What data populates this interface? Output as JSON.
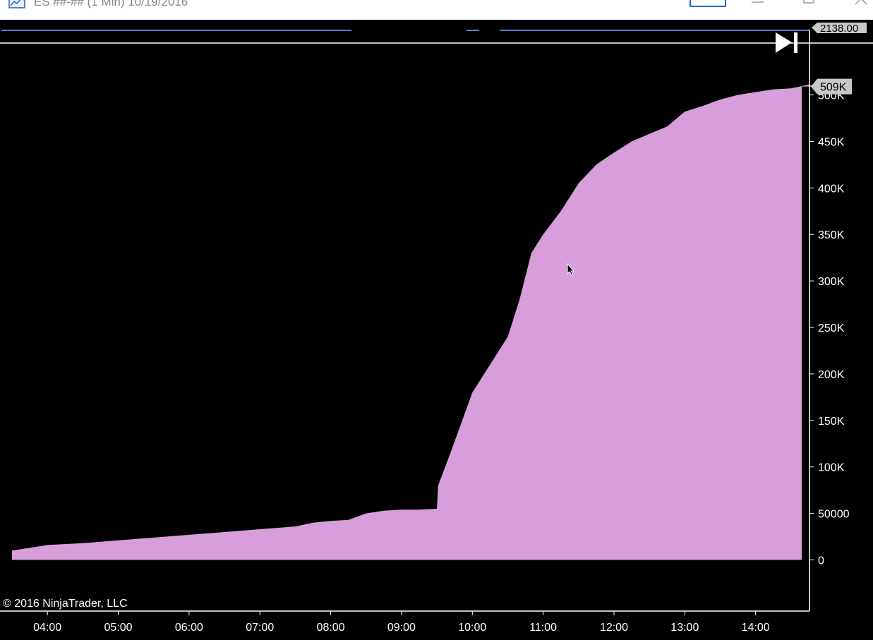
{
  "window": {
    "title": "ES ##-## (1 Min)  10/19/2016",
    "icons": [
      "chart-app-icon",
      "minimize-icon",
      "maximize-icon",
      "close-icon"
    ]
  },
  "top_panel": {
    "price_label": "2138.00"
  },
  "copyright": "© 2016 NinjaTrader, LLC",
  "colors": {
    "background": "#000000",
    "fill": "#d89edc",
    "axis": "#ffffff",
    "price_line": "#5a7bd6",
    "badge": "#c8c8c8"
  },
  "chart_data": {
    "type": "area",
    "ylim": [
      -55000,
      555000
    ],
    "xlim": [
      "03:27",
      "14:57"
    ],
    "y_ticks": [
      0,
      50000,
      100000,
      150000,
      200000,
      250000,
      300000,
      350000,
      400000,
      450000,
      500000
    ],
    "y_tick_labels": [
      "0",
      "50000",
      "100K",
      "150K",
      "200K",
      "250K",
      "300K",
      "350K",
      "400K",
      "450K",
      "500K"
    ],
    "x_ticks": [
      "04:00",
      "05:00",
      "06:00",
      "07:00",
      "08:00",
      "09:00",
      "10:00",
      "11:00",
      "12:00",
      "13:00",
      "14:00"
    ],
    "last_value": 509000,
    "last_value_label": "509K",
    "points": [
      [
        "03:30",
        10000
      ],
      [
        "03:45",
        13000
      ],
      [
        "04:00",
        16000
      ],
      [
        "04:30",
        18000
      ],
      [
        "05:00",
        21000
      ],
      [
        "05:30",
        24000
      ],
      [
        "06:00",
        27000
      ],
      [
        "06:30",
        30000
      ],
      [
        "07:00",
        33000
      ],
      [
        "07:30",
        36000
      ],
      [
        "07:45",
        40000
      ],
      [
        "08:00",
        42000
      ],
      [
        "08:15",
        43000
      ],
      [
        "08:30",
        50000
      ],
      [
        "08:45",
        53000
      ],
      [
        "09:00",
        54000
      ],
      [
        "09:15",
        54000
      ],
      [
        "09:30",
        55000
      ],
      [
        "09:31",
        80000
      ],
      [
        "09:40",
        110000
      ],
      [
        "09:50",
        145000
      ],
      [
        "10:00",
        180000
      ],
      [
        "10:15",
        210000
      ],
      [
        "10:30",
        240000
      ],
      [
        "10:40",
        280000
      ],
      [
        "10:50",
        330000
      ],
      [
        "11:00",
        350000
      ],
      [
        "11:15",
        375000
      ],
      [
        "11:30",
        405000
      ],
      [
        "11:45",
        425000
      ],
      [
        "12:00",
        438000
      ],
      [
        "12:15",
        450000
      ],
      [
        "12:30",
        458000
      ],
      [
        "12:45",
        466000
      ],
      [
        "13:00",
        482000
      ],
      [
        "13:15",
        488000
      ],
      [
        "13:30",
        495000
      ],
      [
        "13:45",
        500000
      ],
      [
        "14:00",
        503000
      ],
      [
        "14:15",
        506000
      ],
      [
        "14:30",
        507000
      ],
      [
        "14:45",
        511000
      ],
      [
        "14:50",
        509000
      ]
    ]
  }
}
